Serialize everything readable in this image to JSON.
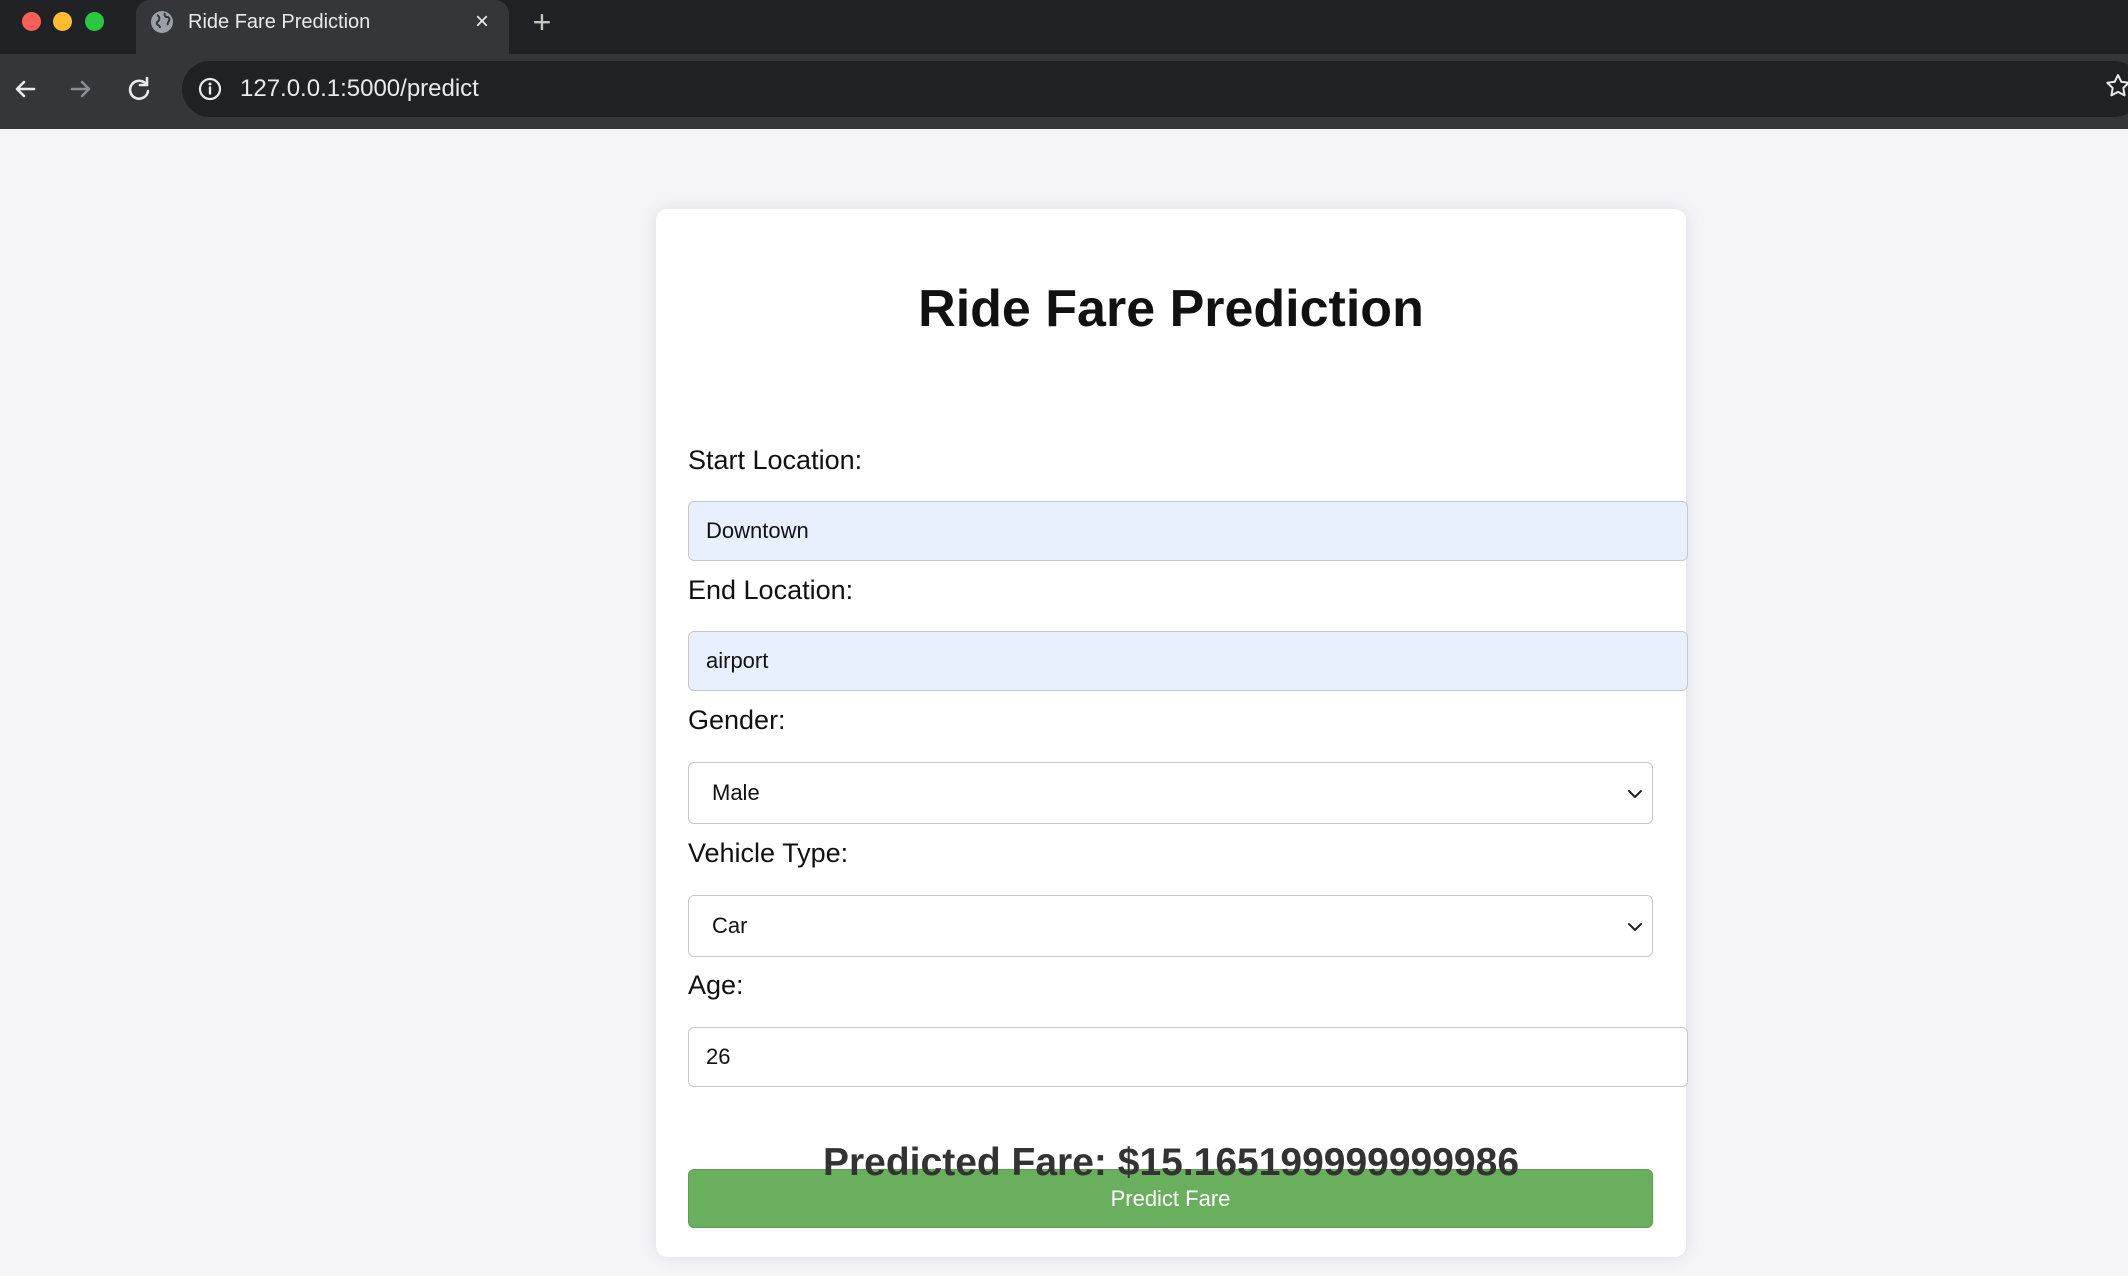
{
  "browser": {
    "tab_title": "Ride Fare Prediction",
    "tab_close": "×",
    "new_tab": "+",
    "url": "127.0.0.1:5000/predict"
  },
  "form": {
    "title": "Ride Fare Prediction",
    "start_label": "Start Location:",
    "start_value": "Downtown",
    "end_label": "End Location:",
    "end_value": "airport",
    "gender_label": "Gender:",
    "gender_value": "Male",
    "vehicle_label": "Vehicle Type:",
    "vehicle_value": "Car",
    "age_label": "Age:",
    "age_value": "26",
    "submit_label": "Predict Fare"
  },
  "result": {
    "text": "Predicted Fare: $15.165199999999986"
  },
  "colors": {
    "button_green": "#6aaf5e",
    "autofill_blue": "#e8f0fe",
    "page_bg": "#f4f4f9",
    "chrome_dark": "#202124"
  }
}
